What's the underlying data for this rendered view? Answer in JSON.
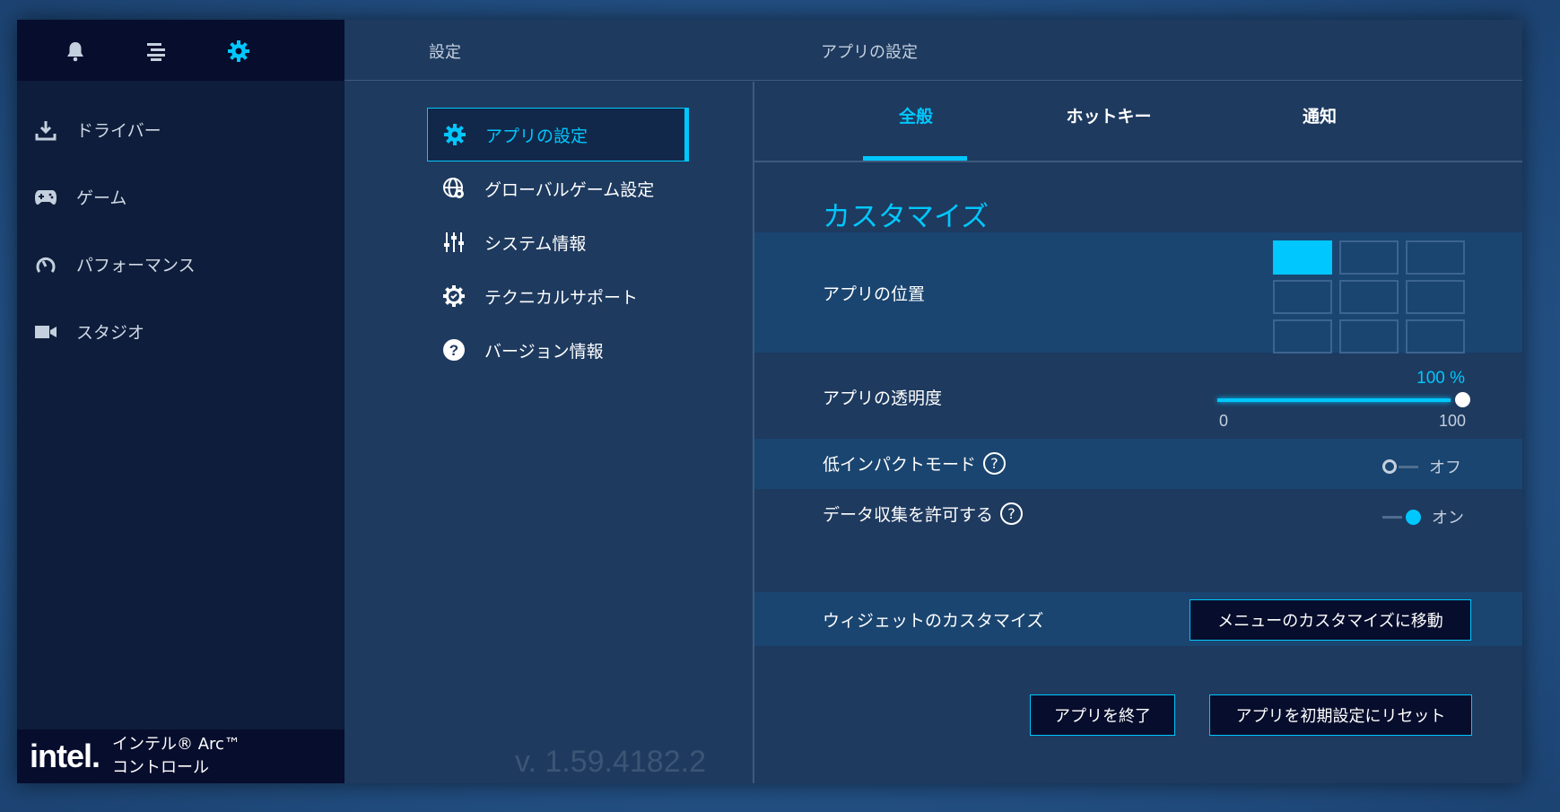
{
  "app": {
    "brand_logo": "intel.",
    "brand_line1": "インテル® Arc™",
    "brand_line2": "コントロール",
    "version": "v. 1.59.4182.2"
  },
  "sidebar": {
    "top_icons": [
      "bell-icon",
      "list-icon",
      "gear-icon"
    ],
    "items": [
      {
        "label": "ドライバー",
        "icon": "download-icon"
      },
      {
        "label": "ゲーム",
        "icon": "gamepad-icon"
      },
      {
        "label": "パフォーマンス",
        "icon": "gauge-icon"
      },
      {
        "label": "スタジオ",
        "icon": "video-camera-icon"
      }
    ]
  },
  "header": {
    "left_title": "設定",
    "right_title": "アプリの設定"
  },
  "menu": {
    "items": [
      {
        "label": "アプリの設定",
        "icon": "gear-icon",
        "active": true
      },
      {
        "label": "グローバルゲーム設定",
        "icon": "globe-gear-icon"
      },
      {
        "label": "システム情報",
        "icon": "sliders-icon"
      },
      {
        "label": "テクニカルサポート",
        "icon": "gear-check-icon"
      },
      {
        "label": "バージョン情報",
        "icon": "question-circle-icon"
      }
    ]
  },
  "tabs": {
    "items": [
      "全般",
      "ホットキー",
      "通知"
    ],
    "active": "全般"
  },
  "settings": {
    "section_title": "カスタマイズ",
    "app_position_label": "アプリの位置",
    "app_position_selected": "top-left",
    "transparency_label": "アプリの透明度",
    "transparency_value": "100 %",
    "transparency_level": 1.0,
    "transparency_min": "0",
    "transparency_max": "100",
    "low_impact_label": "低インパクトモード",
    "low_impact_state": "オフ",
    "data_collection_label": "データ収集を許可する",
    "data_collection_state": "オン",
    "help_glyph": "?",
    "widget_label": "ウィジェットのカスタマイズ",
    "widget_button": "メニューのカスタマイズに移動"
  },
  "actions": {
    "quit": "アプリを終了",
    "reset": "アプリを初期設定にリセット"
  },
  "colors": {
    "accent": "#00c7fd",
    "sidebar_bg": "#0e1d3b",
    "panel_bg": "#1e3a5f"
  }
}
